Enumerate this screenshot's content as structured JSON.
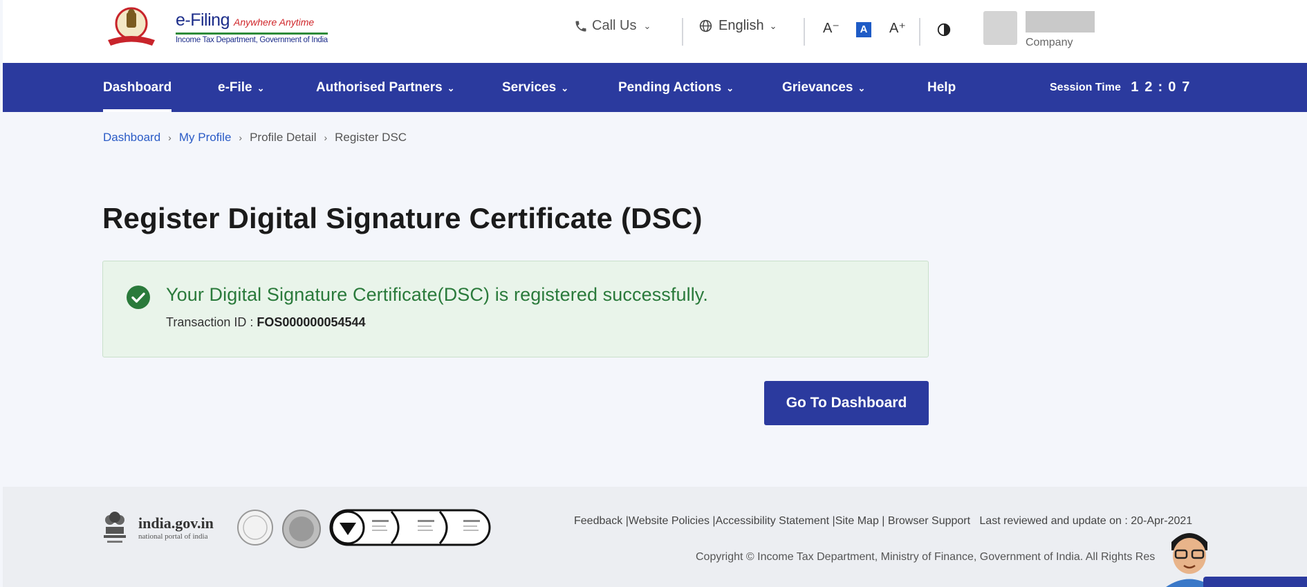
{
  "header": {
    "brand": "e-Filing",
    "tagline": "Anywhere Anytime",
    "department": "Income Tax Department, Government of India",
    "call_us": "Call Us",
    "language": "English",
    "font_decrease": "A⁻",
    "font_default": "A",
    "font_increase": "A⁺",
    "user_role": "Company"
  },
  "nav": {
    "items": [
      {
        "label": "Dashboard",
        "active": true
      },
      {
        "label": "e-File",
        "dropdown": true
      },
      {
        "label": "Authorised Partners",
        "dropdown": true
      },
      {
        "label": "Services",
        "dropdown": true
      },
      {
        "label": "Pending Actions",
        "dropdown": true
      },
      {
        "label": "Grievances",
        "dropdown": true
      },
      {
        "label": "Help"
      }
    ],
    "session_label": "Session Time",
    "session_digits": [
      "1",
      "2",
      "0",
      "7"
    ]
  },
  "breadcrumb": [
    "Dashboard",
    "My Profile",
    "Profile Detail",
    "Register DSC"
  ],
  "main": {
    "title": "Register Digital Signature Certificate (DSC)",
    "success_message": "Your Digital Signature Certificate(DSC) is registered successfully.",
    "transaction_label": "Transaction ID : ",
    "transaction_id": "FOS000000054544",
    "go_button": "Go To Dashboard"
  },
  "footer": {
    "india_gov": "india.gov.in",
    "india_gov_sub": "national portal of india",
    "links": [
      "Feedback",
      "Website Policies",
      "Accessibility Statement",
      "Site Map",
      "Browser Support"
    ],
    "last_reviewed": "Last reviewed and update on : 20-Apr-2021",
    "copyright": "Copyright © Income Tax Department, Ministry of Finance, Government of India. All Rights Res"
  },
  "colors": {
    "primary": "#2b3a9e",
    "success": "#2a7a3b",
    "link": "#2a5bc6"
  }
}
